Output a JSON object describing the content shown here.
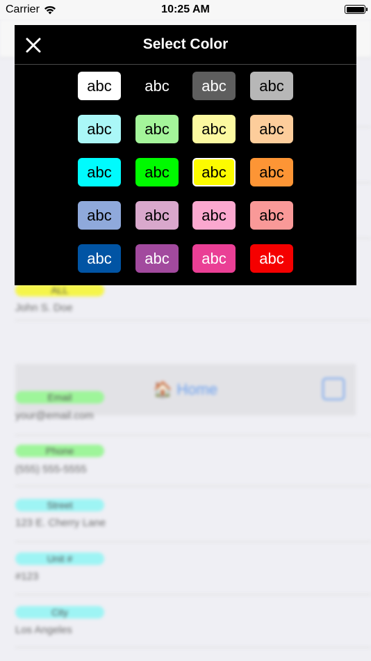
{
  "status_bar": {
    "carrier": "Carrier",
    "time": "10:25 AM"
  },
  "modal": {
    "title": "Select Color",
    "swatches": [
      {
        "label": "abc",
        "bg": "#ffffff",
        "fg": "#000000"
      },
      {
        "label": "abc",
        "bg": "#000000",
        "fg": "#ffffff"
      },
      {
        "label": "abc",
        "bg": "#5e5e5e",
        "fg": "#ffffff"
      },
      {
        "label": "abc",
        "bg": "#b7b7b7",
        "fg": "#000000"
      },
      {
        "label": "abc",
        "bg": "#aaf7f7",
        "fg": "#000000"
      },
      {
        "label": "abc",
        "bg": "#a4f59a",
        "fg": "#000000"
      },
      {
        "label": "abc",
        "bg": "#fcf9a0",
        "fg": "#000000"
      },
      {
        "label": "abc",
        "bg": "#fdcd9b",
        "fg": "#000000"
      },
      {
        "label": "abc",
        "bg": "#00fbfd",
        "fg": "#000000"
      },
      {
        "label": "abc",
        "bg": "#00fa00",
        "fg": "#000000"
      },
      {
        "label": "abc",
        "bg": "#fcfb00",
        "fg": "#000000",
        "selected": true
      },
      {
        "label": "abc",
        "bg": "#fd9535",
        "fg": "#000000"
      },
      {
        "label": "abc",
        "bg": "#8fa9db",
        "fg": "#000000"
      },
      {
        "label": "abc",
        "bg": "#d9a8cc",
        "fg": "#000000"
      },
      {
        "label": "abc",
        "bg": "#fba8cf",
        "fg": "#000000"
      },
      {
        "label": "abc",
        "bg": "#f99998",
        "fg": "#000000"
      },
      {
        "label": "abc",
        "bg": "#0154a4",
        "fg": "#ffffff"
      },
      {
        "label": "abc",
        "bg": "#a24a9e",
        "fg": "#ffffff"
      },
      {
        "label": "abc",
        "bg": "#ea3f95",
        "fg": "#ffffff"
      },
      {
        "label": "abc",
        "bg": "#f50000",
        "fg": "#ffffff"
      }
    ]
  },
  "background": {
    "fields": [
      {
        "tag": "ALL",
        "tag_color": "#f5f54a",
        "value": "John S. Doe"
      },
      {
        "tag": "Email",
        "tag_color": "#9ef59a",
        "value": "your@email.com"
      },
      {
        "tag": "Phone",
        "tag_color": "#9ef59a",
        "value": "(555) 555-5555"
      },
      {
        "tag": "Street",
        "tag_color": "#9ef4f4",
        "value": "123 E. Cherry Lane"
      },
      {
        "tag": "Unit #",
        "tag_color": "#9ef4f4",
        "value": "#123"
      },
      {
        "tag": "City",
        "tag_color": "#9ef4f4",
        "value": "Los Angeles"
      }
    ],
    "home_label": "🏠 Home"
  }
}
